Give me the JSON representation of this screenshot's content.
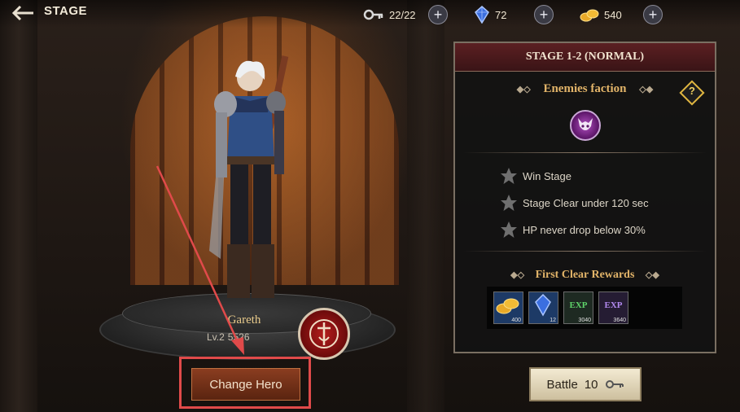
{
  "header": {
    "back_icon": "back-arrow-icon",
    "title": "STAGE",
    "resources": [
      {
        "icon": "key-icon",
        "value": "22/22"
      },
      {
        "icon": "crystal-icon",
        "value": "72"
      },
      {
        "icon": "gold-icon",
        "value": "540"
      }
    ],
    "plus_label": "+"
  },
  "hero": {
    "name": "Gareth",
    "level": "Lv.2",
    "power": "5526",
    "emblem_icon": "sword-emblem-icon",
    "change_button": "Change Hero"
  },
  "stage_panel": {
    "title": "STAGE 1-2 (NORMAL)",
    "enemies_title": "Enemies faction",
    "help_label": "?",
    "faction_icon": "demon-faction-icon",
    "objectives": [
      "Win Stage",
      "Stage Clear under 120 sec",
      "HP never drop below 30%"
    ],
    "rewards_title": "First Clear Rewards",
    "rewards": [
      {
        "icon": "gold-coins-icon",
        "qty": "400"
      },
      {
        "icon": "crystal-icon",
        "qty": "12"
      },
      {
        "icon": "exp-green-icon",
        "label": "EXP",
        "qty": "3040"
      },
      {
        "icon": "exp-purple-icon",
        "label": "EXP",
        "qty": "3640"
      }
    ]
  },
  "battle": {
    "label": "Battle",
    "cost": "10",
    "cost_icon": "key-icon"
  },
  "colors": {
    "accent_gold": "#e2b469",
    "header_red": "#5b1f22",
    "highlight_red": "#e04a4a"
  }
}
